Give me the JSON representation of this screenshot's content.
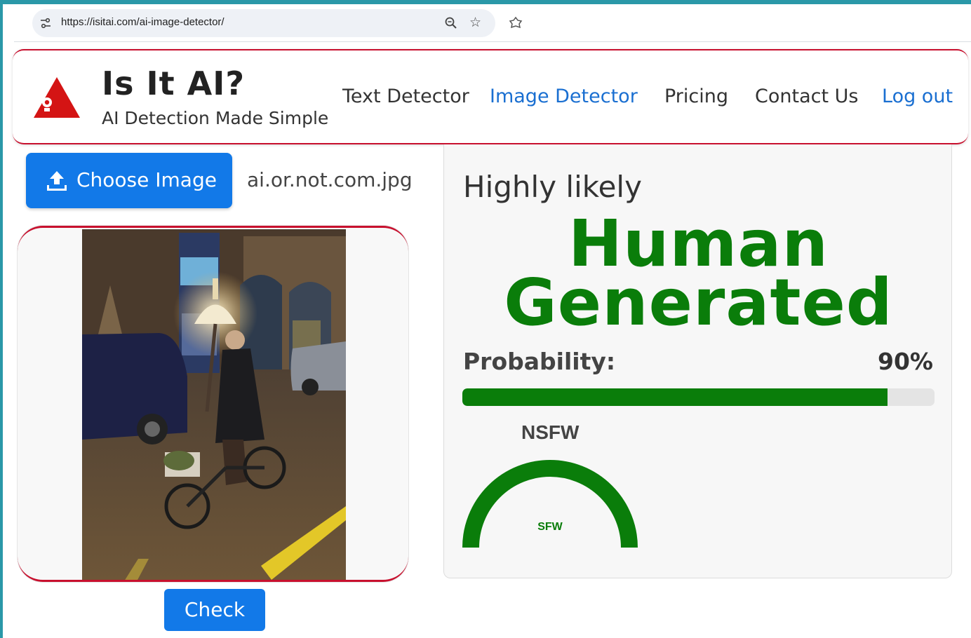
{
  "browser": {
    "url": "https://isitai.com/ai-image-detector/",
    "icons": [
      "site-settings-icon",
      "zoom-icon",
      "star-icon",
      "extensions-icon"
    ]
  },
  "brand": {
    "title": "Is It AI?",
    "subtitle": "AI Detection Made Simple",
    "logo": "red-triangle-logo-icon"
  },
  "nav": {
    "items": [
      {
        "label": "Text Detector",
        "active": false
      },
      {
        "label": "Image Detector",
        "active": true
      },
      {
        "label": "Pricing",
        "active": false
      },
      {
        "label": "Contact Us",
        "active": false
      },
      {
        "label": "Log out",
        "active": false
      }
    ]
  },
  "upload": {
    "button_label": "Choose Image",
    "filename": "ai.or.not.com.jpg",
    "check_label": "Check"
  },
  "result": {
    "likelihood": "Highly likely",
    "verdict_line1": "Human",
    "verdict_line2": "Generated",
    "probability_label": "Probability:",
    "probability_value": "90%",
    "probability_fraction": 0.9,
    "nsfw_title": "NSFW",
    "nsfw_gauge_label": "SFW",
    "nsfw_gauge_level": 1.0
  },
  "colors": {
    "accent_blue": "#1279e8",
    "brand_red": "#c8102e",
    "result_green": "#0a7d0a"
  }
}
